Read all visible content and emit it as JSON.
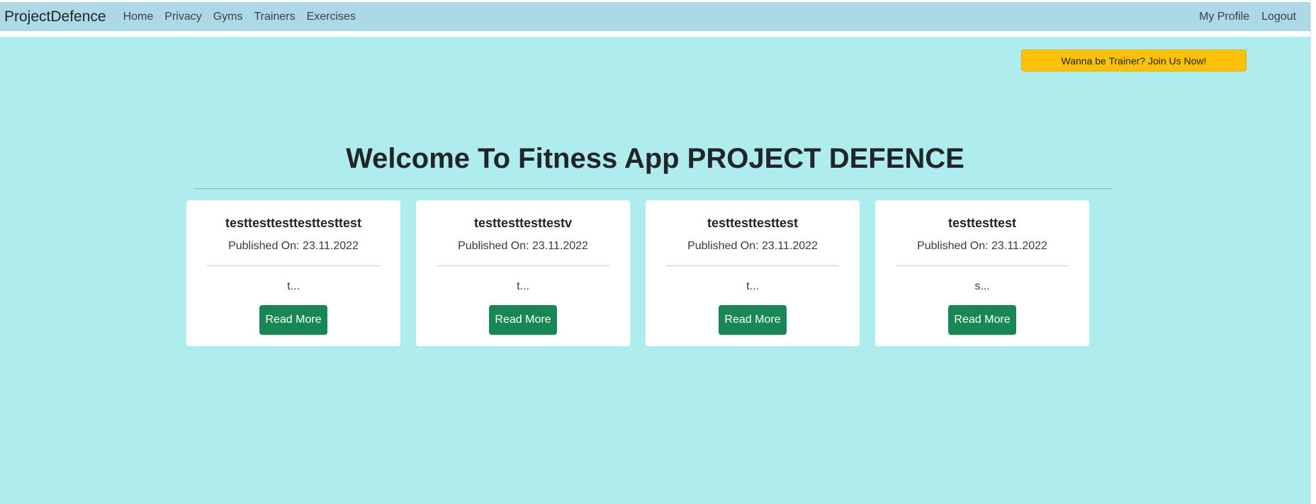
{
  "navbar": {
    "brand": "ProjectDefence",
    "links": [
      "Home",
      "Privacy",
      "Gyms",
      "Trainers",
      "Exercises"
    ],
    "right_links": [
      "My Profile",
      "Logout"
    ]
  },
  "trainer_button": "Wanna be Trainer? Join Us Now!",
  "page_title": "Welcome To Fitness App PROJECT DEFENCE",
  "cards": [
    {
      "title": "testtesttesttesttesttest",
      "published": "Published On: 23.11.2022",
      "excerpt": "t...",
      "button": "Read More"
    },
    {
      "title": "testtesttesttestv",
      "published": "Published On: 23.11.2022",
      "excerpt": "t...",
      "button": "Read More"
    },
    {
      "title": "testtesttesttest",
      "published": "Published On: 23.11.2022",
      "excerpt": "t...",
      "button": "Read More"
    },
    {
      "title": "testtesttest",
      "published": "Published On: 23.11.2022",
      "excerpt": "s...",
      "button": "Read More"
    }
  ],
  "colors": {
    "navbar": "#add8e6",
    "background": "#afecee",
    "warning_button": "#ffc107",
    "success_button": "#198754"
  }
}
